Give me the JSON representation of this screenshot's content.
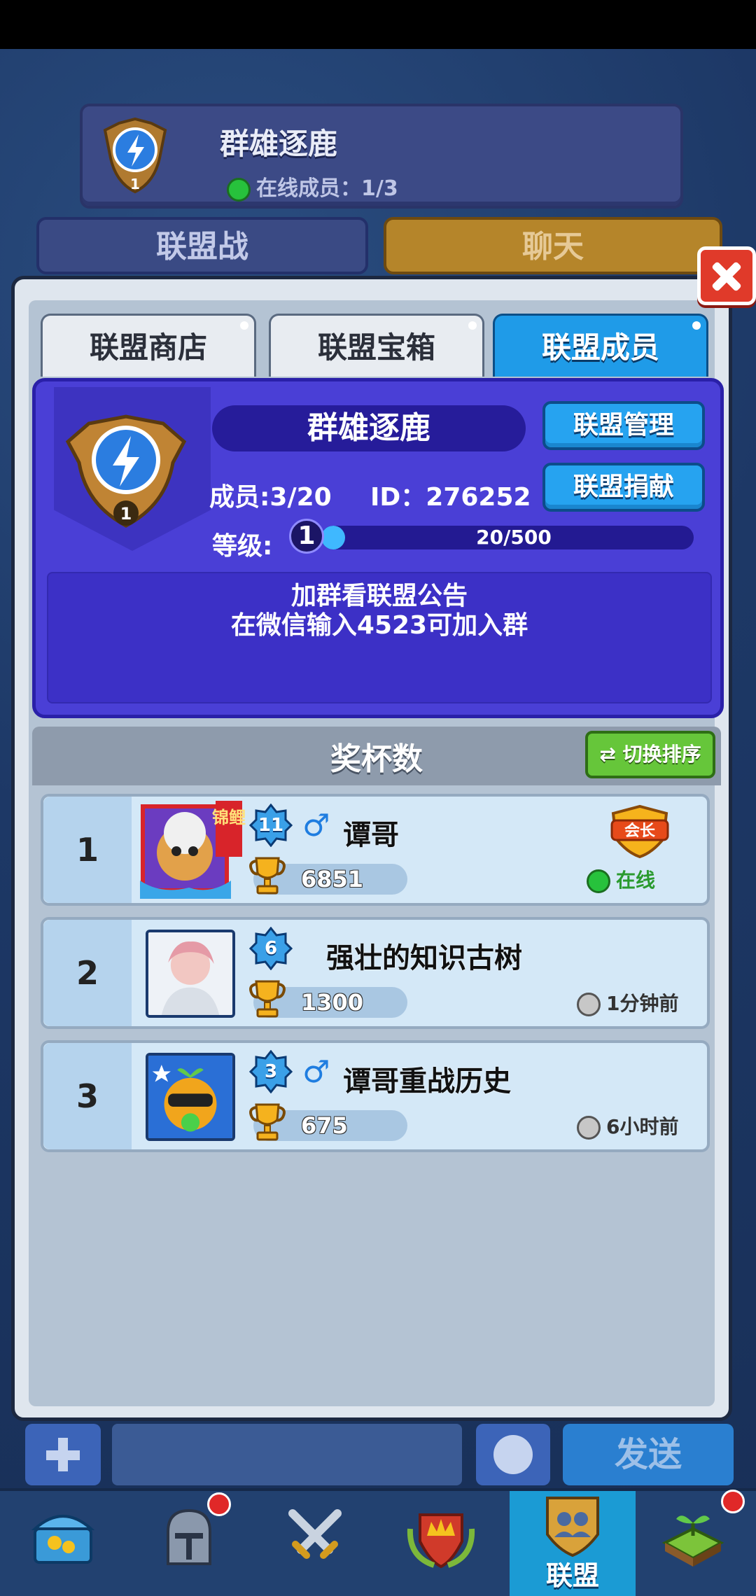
{
  "header": {
    "guild_name": "群雄逐鹿",
    "online_label": "在线成员：1/3",
    "badge_level": "1"
  },
  "top_tabs": [
    "联盟战",
    "聊天"
  ],
  "sub_tabs": [
    "联盟商店",
    "联盟宝箱",
    "联盟成员"
  ],
  "guild_info": {
    "name": "群雄逐鹿",
    "members": "成员:3/20",
    "id": "ID：276252",
    "level_label": "等级:",
    "level": "1",
    "exp_text": "20/500",
    "exp_fraction": 0.04,
    "badge_level": "1",
    "manage_button": "联盟管理",
    "donate_button": "联盟捐献",
    "notice_line1": "加群看联盟公告",
    "notice_line2": "在微信输入4523可加入群"
  },
  "ranking": {
    "title": "奖杯数",
    "switch_button": "切换排序",
    "members": [
      {
        "rank": "1",
        "level": "11",
        "gender": "♂",
        "name": "谭哥",
        "trophies": "6851",
        "status": "在线",
        "online": true,
        "frame_tag": "锦鲤",
        "role": "会长"
      },
      {
        "rank": "2",
        "level": "6",
        "gender": "",
        "name": "强壮的知识古树",
        "trophies": "1300",
        "status": "1分钟前",
        "online": false
      },
      {
        "rank": "3",
        "level": "3",
        "gender": "♂",
        "name": "谭哥重战历史",
        "trophies": "675",
        "status": "6小时前",
        "online": false
      }
    ]
  },
  "input_bar": {
    "send_button": "发送"
  },
  "navbar": {
    "items": [
      "chest-icon",
      "knight-helmet-icon",
      "crossed-swords-icon",
      "crown-shield-icon",
      "guild-members-icon",
      "sprout-icon"
    ],
    "active_label": "联盟"
  },
  "colors": {
    "accent_blue": "#1f9be8",
    "panel_purple": "#4a3fd6",
    "online_green": "#27c23c"
  }
}
